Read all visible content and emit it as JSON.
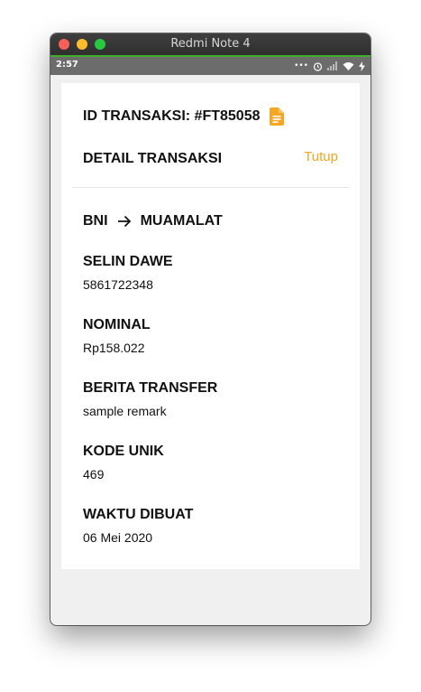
{
  "window": {
    "title": "Redmi Note 4"
  },
  "statusbar": {
    "time": "2:57",
    "icons": [
      "more-dots-icon",
      "alarm-icon",
      "signal-icon",
      "wifi-icon",
      "charging-icon"
    ]
  },
  "transaction": {
    "id_label": "ID TRANSAKSI: #FT85058",
    "detail_title": "DETAIL TRANSAKSI",
    "close_label": "Tutup",
    "from_bank": "BNI",
    "to_bank": "MUAMALAT",
    "fields": [
      {
        "label": "SELIN DAWE",
        "value": "5861722348"
      },
      {
        "label": "NOMINAL",
        "value": "Rp158.022"
      },
      {
        "label": "BERITA TRANSFER",
        "value": "sample remark"
      },
      {
        "label": "KODE UNIK",
        "value": "469"
      },
      {
        "label": "WAKTU DIBUAT",
        "value": "06 Mei 2020"
      }
    ]
  },
  "colors": {
    "accent": "#f5a623",
    "titlebar": "#333333",
    "statusbar": "#6c6c6c",
    "background": "#eff0ef"
  }
}
